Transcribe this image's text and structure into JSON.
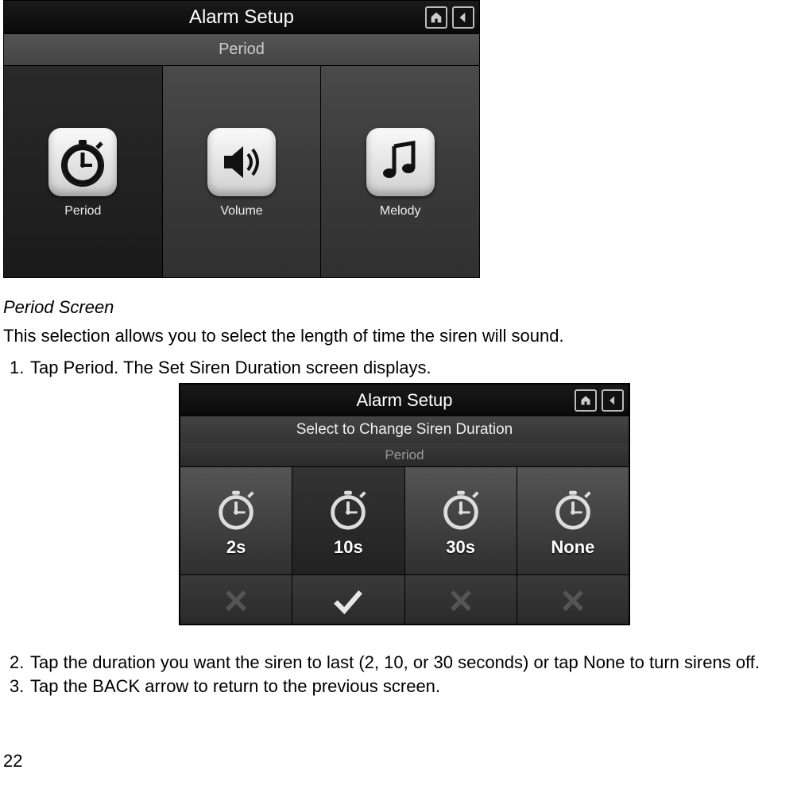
{
  "screenshot1": {
    "title": "Alarm Setup",
    "subtitle": "Period",
    "tiles": [
      {
        "label": "Period",
        "icon": "clock",
        "selected": true
      },
      {
        "label": "Volume",
        "icon": "speaker",
        "selected": false
      },
      {
        "label": "Melody",
        "icon": "music",
        "selected": false
      }
    ]
  },
  "section_heading": "Period Screen",
  "intro_text": "This selection allows you to select the length of time the siren will sound.",
  "step1": "Tap Period. The Set Siren Duration screen displays.",
  "screenshot2": {
    "title": "Alarm Setup",
    "line_a": "Select to Change Siren Duration",
    "line_b": "Period",
    "options": [
      {
        "value": "2s",
        "selected": false
      },
      {
        "value": "10s",
        "selected": true
      },
      {
        "value": "30s",
        "selected": false
      },
      {
        "value": "None",
        "selected": false
      }
    ]
  },
  "step2": "Tap the duration you want the siren to last (2, 10, or 30 seconds) or tap None to turn sirens off.",
  "step3": "Tap the BACK arrow to return to the previous screen.",
  "page_number": "22"
}
